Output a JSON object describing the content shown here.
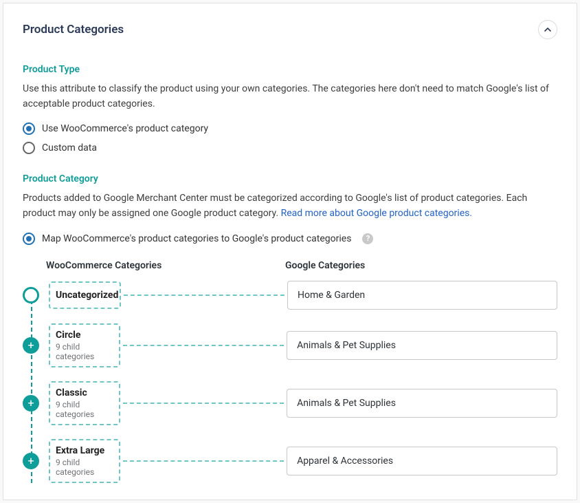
{
  "panel": {
    "title": "Product Categories"
  },
  "product_type": {
    "heading": "Product Type",
    "description": "Use this attribute to classify the product using your own categories. The categories here don't need to match Google's list of acceptable product categories.",
    "options": {
      "0": {
        "label": "Use WooCommerce's product category",
        "checked": true
      },
      "1": {
        "label": "Custom data",
        "checked": false
      }
    }
  },
  "product_category": {
    "heading": "Product Category",
    "description_1": "Products added to Google Merchant Center must be categorized according to Google's list of product categories. Each product may only be assigned one Google product category. ",
    "link_text": "Read more about Google product categories.",
    "map_option": {
      "label": "Map WooCommerce's product categories to Google's product categories"
    }
  },
  "columns": {
    "woo": "WooCommerce Categories",
    "google": "Google Categories"
  },
  "mappings": {
    "0": {
      "name": "Uncategorized",
      "children": "",
      "google": "Home & Garden",
      "hasChildren": false
    },
    "1": {
      "name": "Circle",
      "children": "9 child categories",
      "google": "Animals & Pet Supplies",
      "hasChildren": true
    },
    "2": {
      "name": "Classic",
      "children": "9 child categories",
      "google": "Animals & Pet Supplies",
      "hasChildren": true
    },
    "3": {
      "name": "Extra Large",
      "children": "9 child categories",
      "google": "Apparel & Accessories",
      "hasChildren": true
    }
  }
}
